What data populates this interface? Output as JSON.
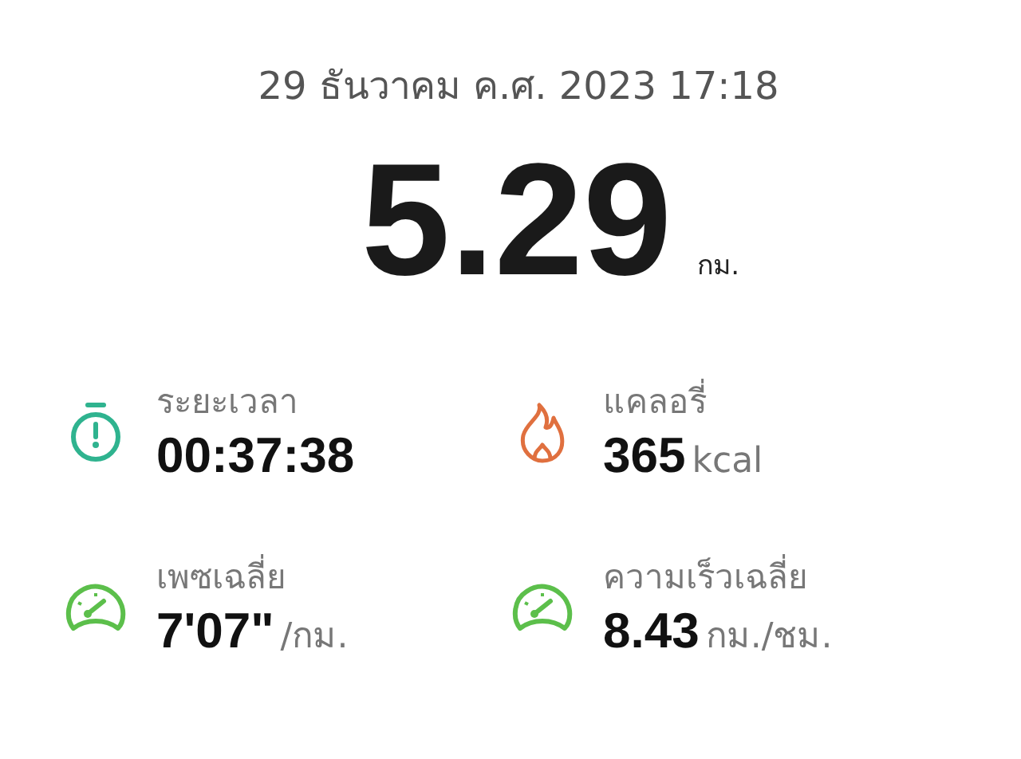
{
  "date": "29 ธันวาคม ค.ศ. 2023 17:18",
  "distance": {
    "value": "5.29",
    "unit": "กม."
  },
  "metrics": [
    {
      "kind": "stopwatch",
      "color": "#2fb38f",
      "label": "ระยะเวลา",
      "value": "00:37:38"
    },
    {
      "kind": "flame",
      "color": "#e0703f",
      "label": "แคลอรี่",
      "value": "365",
      "unit": "kcal"
    },
    {
      "kind": "gauge",
      "color": "#5cbf4b",
      "label": "เพซเฉลี่ย",
      "value": "7'07\"",
      "unit": "/กม."
    },
    {
      "kind": "gauge",
      "color": "#5cbf4b",
      "label": "ความเร็วเฉลี่ย",
      "value": "8.43",
      "unit": "กม./ชม."
    }
  ]
}
